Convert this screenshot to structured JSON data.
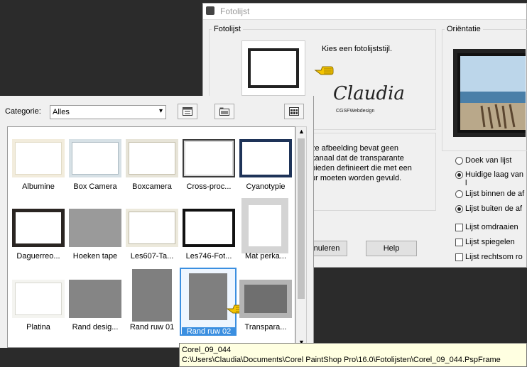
{
  "bg_dialog": {
    "title": "Fotolijst",
    "group_fotolijst": "Fotolijst",
    "choose_label": "Kies een fotolijststijl.",
    "signature": "Claudia",
    "signature_sub": "CGSFWebdesign",
    "info_lines": [
      "ze afbeelding bevat geen",
      "kanaal dat de transparante",
      "bieden definieert die met een",
      "ur moeten worden gevuld."
    ],
    "cancel_label": "nuleren",
    "help_label": "Help",
    "group_orientatie": "Oriëntatie",
    "options": {
      "doek": "Doek van lijst",
      "huidige": "Huidige laag van l",
      "binnen": "Lijst binnen de af",
      "buiten": "Lijst buiten de af",
      "omdraaien": "Lijst omdraaien",
      "spiegelen": "Lijst spiegelen",
      "rechtsom": "Lijst rechtsom ro"
    }
  },
  "picker": {
    "category_label": "Categorie:",
    "category_value": "Alles",
    "items": [
      {
        "label": "Albumine"
      },
      {
        "label": "Box Camera"
      },
      {
        "label": "Boxcamera"
      },
      {
        "label": "Cross-proc..."
      },
      {
        "label": "Cyanotypie"
      },
      {
        "label": "Daguerreo..."
      },
      {
        "label": "Hoeken tape"
      },
      {
        "label": "Les607-Ta..."
      },
      {
        "label": "Les746-Fot..."
      },
      {
        "label": "Mat perka..."
      },
      {
        "label": "Platina"
      },
      {
        "label": "Rand desig..."
      },
      {
        "label": "Rand ruw 01"
      },
      {
        "label": "Rand ruw 02"
      },
      {
        "label": "Transpara..."
      }
    ]
  },
  "tooltip": {
    "name": "Corel_09_044",
    "path": "C:\\Users\\Claudia\\Documents\\Corel PaintShop Pro\\16.0\\Fotolijsten\\Corel_09_044.PspFrame"
  },
  "colors": {
    "selection": "#3b8fe0",
    "pointer": "#f4c400"
  }
}
